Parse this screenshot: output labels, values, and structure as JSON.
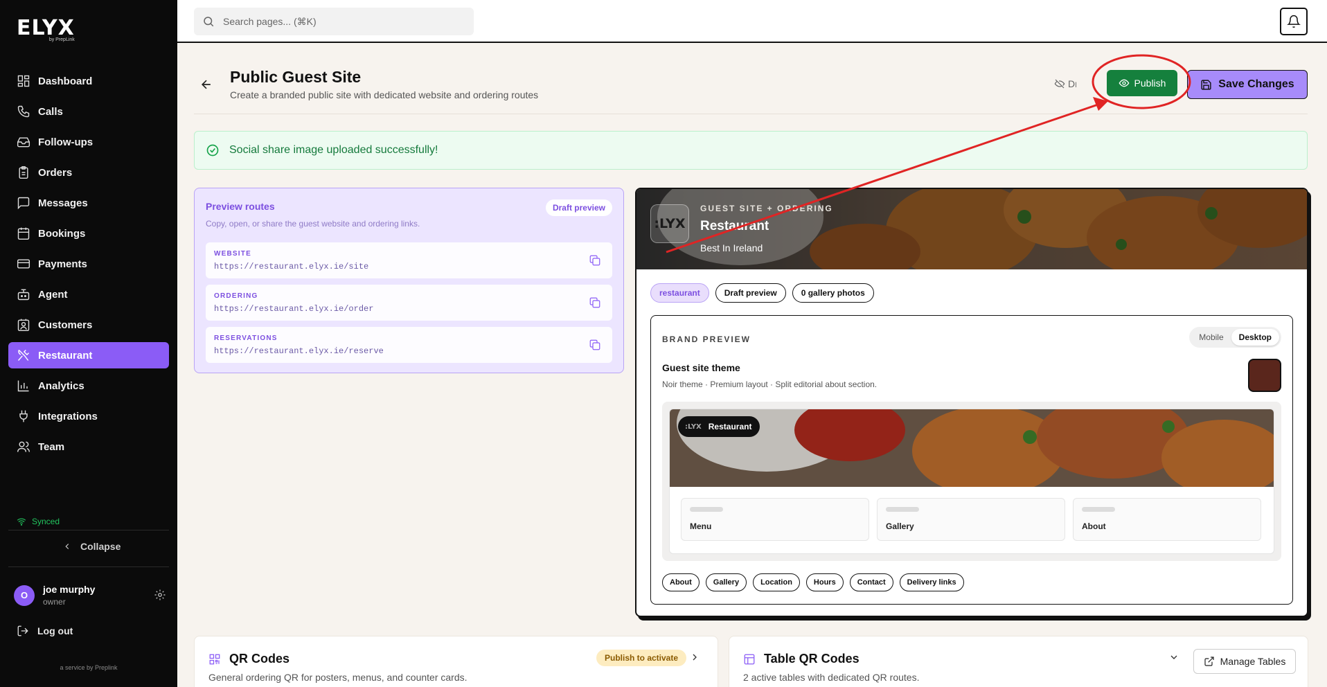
{
  "brand": {
    "logo": "ELYX",
    "logo_sub": "by PrepLink",
    "accent": "#8b5cf6"
  },
  "search": {
    "placeholder": "Search pages... (⌘K)"
  },
  "sidebar": {
    "items": [
      {
        "label": "Dashboard",
        "icon": "dashboard-icon"
      },
      {
        "label": "Calls",
        "icon": "phone-icon"
      },
      {
        "label": "Follow-ups",
        "icon": "inbox-icon"
      },
      {
        "label": "Orders",
        "icon": "clipboard-icon"
      },
      {
        "label": "Messages",
        "icon": "message-icon"
      },
      {
        "label": "Bookings",
        "icon": "calendar-icon"
      },
      {
        "label": "Payments",
        "icon": "credit-card-icon"
      },
      {
        "label": "Agent",
        "icon": "bot-icon"
      },
      {
        "label": "Customers",
        "icon": "contact-icon"
      },
      {
        "label": "Restaurant",
        "icon": "utensils-icon",
        "active": true
      },
      {
        "label": "Analytics",
        "icon": "bar-chart-icon"
      },
      {
        "label": "Integrations",
        "icon": "plug-icon"
      },
      {
        "label": "Team",
        "icon": "users-icon"
      }
    ],
    "synced": "Synced",
    "collapse": "Collapse",
    "user": {
      "initial": "O",
      "name": "joe murphy",
      "role": "owner"
    },
    "logout": "Log out",
    "service": "a service by Preplink"
  },
  "header": {
    "title": "Public Guest Site",
    "subtitle": "Create a branded public site with dedicated website and ordering routes",
    "status": "Draft",
    "publish": "Publish",
    "save": "Save Changes"
  },
  "alert": {
    "message": "Social share image uploaded successfully!"
  },
  "routes": {
    "title": "Preview routes",
    "description": "Copy, open, or share the guest website and ordering links.",
    "badge": "Draft preview",
    "items": [
      {
        "label": "WEBSITE",
        "url": "https://restaurant.elyx.ie/site"
      },
      {
        "label": "ORDERING",
        "url": "https://restaurant.elyx.ie/order"
      },
      {
        "label": "RESERVATIONS",
        "url": "https://restaurant.elyx.ie/reserve"
      }
    ]
  },
  "guest": {
    "logo_text": ":LYX",
    "kicker": "GUEST SITE + ORDERING",
    "name": "Restaurant",
    "tagline": "Best In Ireland",
    "tags": [
      "restaurant",
      "Draft preview",
      "0 gallery photos"
    ]
  },
  "brand_preview": {
    "title": "BRAND PREVIEW",
    "toggle": [
      "Mobile",
      "Desktop"
    ],
    "toggle_selected": "Desktop",
    "theme_title": "Guest site theme",
    "theme_desc": "Noir theme · Premium layout · Split editorial about section.",
    "theme_color": "#5a261c",
    "mock_name": "Restaurant",
    "mock_logo": ":LYX",
    "cards": [
      "Menu",
      "Gallery",
      "About"
    ],
    "chips": [
      "About",
      "Gallery",
      "Location",
      "Hours",
      "Contact",
      "Delivery links"
    ]
  },
  "qr": {
    "title": "QR Codes",
    "description": "General ordering QR for posters, menus, and counter cards.",
    "badge": "Publish to activate"
  },
  "table_qr": {
    "title": "Table QR Codes",
    "description": "2 active tables with dedicated QR routes.",
    "manage": "Manage Tables"
  }
}
